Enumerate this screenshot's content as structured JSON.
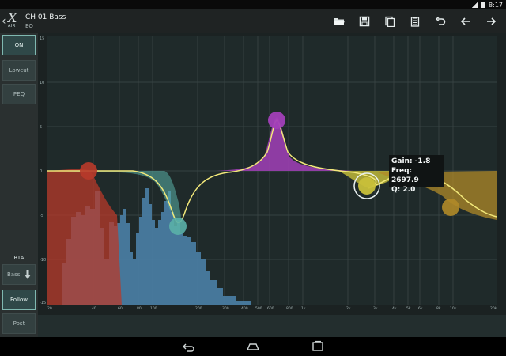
{
  "status": {
    "time": "8:17"
  },
  "header": {
    "logo_text": "X",
    "logo_sub": "AIR",
    "channel_name": "CH 01 Bass",
    "section": "EQ",
    "toolbar": [
      "folder-open-icon",
      "save-icon",
      "copy-icon",
      "paste-icon",
      "undo-icon",
      "arrow-left-icon",
      "arrow-right-icon"
    ]
  },
  "left_panel": {
    "buttons": [
      {
        "label": "ON",
        "active": true
      },
      {
        "label": "Lowcut",
        "active": false
      },
      {
        "label": "PEQ",
        "active": false
      }
    ],
    "rta_label": "RTA",
    "rta_source": "Bass",
    "follow_label": "Follow",
    "post_label": "Post"
  },
  "graph": {
    "y_axis_labels": [
      "15",
      "10",
      "5",
      "0",
      "-5",
      "-10",
      "-15"
    ],
    "x_axis_labels": [
      "20",
      "40",
      "60",
      "80",
      "100",
      "200",
      "300",
      "400",
      "500",
      "600",
      "800",
      "1k",
      "2k",
      "3k",
      "4k",
      "5k",
      "6k",
      "8k",
      "10k",
      "20k"
    ],
    "tooltip": {
      "gain": "Gain: -1.8",
      "freq": "Freq: 2697.9",
      "q": "Q: 2.0"
    },
    "colors": {
      "band1": "#b83a2a",
      "band2": "#5ab0a8",
      "band3": "#a23fb8",
      "band4": "#c8c03a",
      "band5": "#b08a28",
      "rta": "#4a7fa6",
      "curve": "#f2e87a"
    }
  }
}
